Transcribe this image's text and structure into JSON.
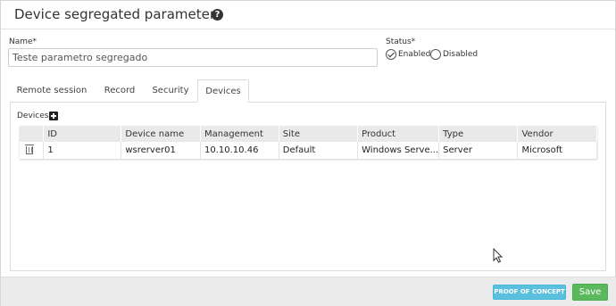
{
  "dialog": {
    "title": "Device segregated parameters",
    "help_icon": "question-circle-icon"
  },
  "form": {
    "name_label": "Name*",
    "name_value": "Teste parametro segregado",
    "status_label": "Status*",
    "status_options": [
      "Enabled",
      "Disabled"
    ],
    "status_selected": "Enabled"
  },
  "tabs": [
    {
      "label": "Remote session",
      "active": false
    },
    {
      "label": "Record",
      "active": false
    },
    {
      "label": "Security",
      "active": false
    },
    {
      "label": "Devices",
      "active": true
    }
  ],
  "devices": {
    "label": "Devices",
    "add_icon": "plus-square-icon",
    "columns": [
      "",
      "ID",
      "Device name",
      "Management",
      "Site",
      "Product",
      "Type",
      "Vendor"
    ],
    "rows": [
      {
        "delete_icon": "trash-icon",
        "id": "1",
        "device_name": "wsrerver01",
        "management": "10.10.10.46",
        "site": "Default",
        "product": "Windows Serve...",
        "type": "Server",
        "vendor": "Microsoft"
      }
    ]
  },
  "footer": {
    "poc_label": "PROOF OF CONCEPT",
    "save_label": "Save"
  },
  "colors": {
    "poc_button": "#5bc0de",
    "save_button": "#5cb85c",
    "footer_bg": "#ebebeb",
    "table_header_bg": "#e9e9e9"
  }
}
